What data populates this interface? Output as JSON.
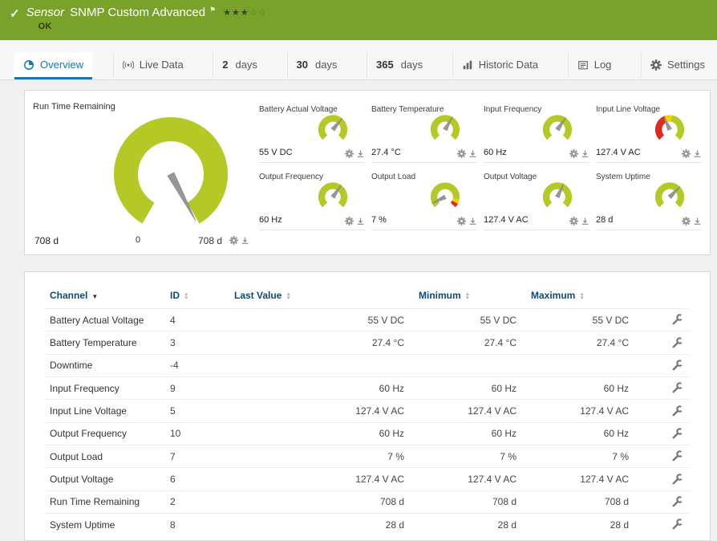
{
  "colors": {
    "header_bg": "#78a22a",
    "accent_blue": "#1a78b0",
    "navy": "#0d4976",
    "gauge_green": "#b5c926",
    "gauge_red": "#dd2b1c",
    "gauge_yellow": "#f8cf00"
  },
  "header": {
    "type_label": "Sensor",
    "title": "SNMP Custom Advanced",
    "status": "OK",
    "rating": {
      "filled": 3,
      "total": 5
    }
  },
  "tabs": [
    {
      "label": "Overview",
      "icon": "pie",
      "active": true
    },
    {
      "label": "Live Data",
      "icon": "broadcast",
      "active": false
    },
    {
      "num": "2",
      "label": "days",
      "active": false
    },
    {
      "num": "30",
      "label": "days",
      "active": false
    },
    {
      "num": "365",
      "label": "days",
      "active": false
    },
    {
      "label": "Historic Data",
      "icon": "bars",
      "active": false
    },
    {
      "label": "Log",
      "icon": "log",
      "active": false
    },
    {
      "label": "Settings",
      "icon": "gear",
      "active": false
    }
  ],
  "overview": {
    "main_gauge": {
      "title": "Run Time Remaining",
      "value": "708 d",
      "scale_min": "0",
      "scale_max": "708 d",
      "needle_deg": 152,
      "segments": [
        [
          -150,
          150,
          "green"
        ]
      ]
    },
    "gauges": [
      {
        "title": "Battery Actual Voltage",
        "value": "55 V DC",
        "needle_deg": 40,
        "segments": [
          [
            -135,
            135,
            "green"
          ]
        ]
      },
      {
        "title": "Battery Temperature",
        "value": "27.4 °C",
        "needle_deg": 30,
        "segments": [
          [
            -135,
            135,
            "green"
          ]
        ]
      },
      {
        "title": "Input Frequency",
        "value": "60 Hz",
        "needle_deg": 35,
        "segments": [
          [
            -135,
            135,
            "green"
          ]
        ]
      },
      {
        "title": "Input Line Voltage",
        "value": "127.4 V AC",
        "needle_deg": -25,
        "segments": [
          [
            -135,
            -20,
            "red"
          ],
          [
            -20,
            10,
            "yellow"
          ],
          [
            10,
            135,
            "green"
          ]
        ]
      },
      {
        "title": "Output Frequency",
        "value": "60 Hz",
        "needle_deg": 35,
        "segments": [
          [
            -135,
            135,
            "green"
          ]
        ]
      },
      {
        "title": "Output Load",
        "value": "7 %",
        "needle_deg": -115,
        "segments": [
          [
            -135,
            100,
            "green"
          ],
          [
            100,
            118,
            "yellow"
          ],
          [
            118,
            135,
            "red"
          ]
        ]
      },
      {
        "title": "Output Voltage",
        "value": "127.4 V AC",
        "needle_deg": 25,
        "segments": [
          [
            -135,
            135,
            "green"
          ]
        ]
      },
      {
        "title": "System Uptime",
        "value": "28 d",
        "needle_deg": 45,
        "segments": [
          [
            -135,
            135,
            "green"
          ]
        ]
      }
    ]
  },
  "table": {
    "columns": [
      {
        "label": "Channel",
        "sorted": true
      },
      {
        "label": "ID"
      },
      {
        "label": "Last Value"
      },
      {
        "label": "Minimum"
      },
      {
        "label": "Maximum"
      },
      {
        "label": ""
      }
    ],
    "rows": [
      {
        "channel": "Battery Actual Voltage",
        "id": "4",
        "last_value": "55 V DC",
        "minimum": "55 V DC",
        "maximum": "55 V DC"
      },
      {
        "channel": "Battery Temperature",
        "id": "3",
        "last_value": "27.4 °C",
        "minimum": "27.4 °C",
        "maximum": "27.4 °C"
      },
      {
        "channel": "Downtime",
        "id": "-4",
        "last_value": "",
        "minimum": "",
        "maximum": ""
      },
      {
        "channel": "Input Frequency",
        "id": "9",
        "last_value": "60 Hz",
        "minimum": "60 Hz",
        "maximum": "60 Hz"
      },
      {
        "channel": "Input Line Voltage",
        "id": "5",
        "last_value": "127.4 V AC",
        "minimum": "127.4 V AC",
        "maximum": "127.4 V AC"
      },
      {
        "channel": "Output Frequency",
        "id": "10",
        "last_value": "60 Hz",
        "minimum": "60 Hz",
        "maximum": "60 Hz"
      },
      {
        "channel": "Output Load",
        "id": "7",
        "last_value": "7 %",
        "minimum": "7 %",
        "maximum": "7 %"
      },
      {
        "channel": "Output Voltage",
        "id": "6",
        "last_value": "127.4 V AC",
        "minimum": "127.4 V AC",
        "maximum": "127.4 V AC"
      },
      {
        "channel": "Run Time Remaining",
        "id": "2",
        "last_value": "708 d",
        "minimum": "708 d",
        "maximum": "708 d"
      },
      {
        "channel": "System Uptime",
        "id": "8",
        "last_value": "28 d",
        "minimum": "28 d",
        "maximum": "28 d"
      }
    ]
  }
}
